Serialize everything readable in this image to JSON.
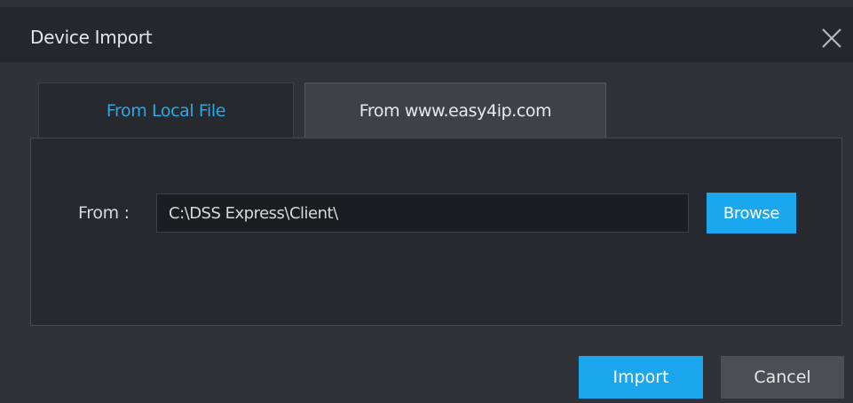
{
  "dialog": {
    "title": "Device Import",
    "close_icon": "close-icon"
  },
  "tabs": [
    {
      "label": "From Local File",
      "active": true
    },
    {
      "label": "From www.easy4ip.com",
      "active": false
    }
  ],
  "form": {
    "from_label": "From :",
    "path_value": "C:\\DSS Express\\Client\\",
    "browse_label": "Browse"
  },
  "footer": {
    "import_label": "Import",
    "cancel_label": "Cancel"
  },
  "colors": {
    "accent": "#1aa7ee",
    "active_tab_text": "#2aa9e8",
    "background": "#2f3237",
    "titlebar": "#24272b"
  }
}
